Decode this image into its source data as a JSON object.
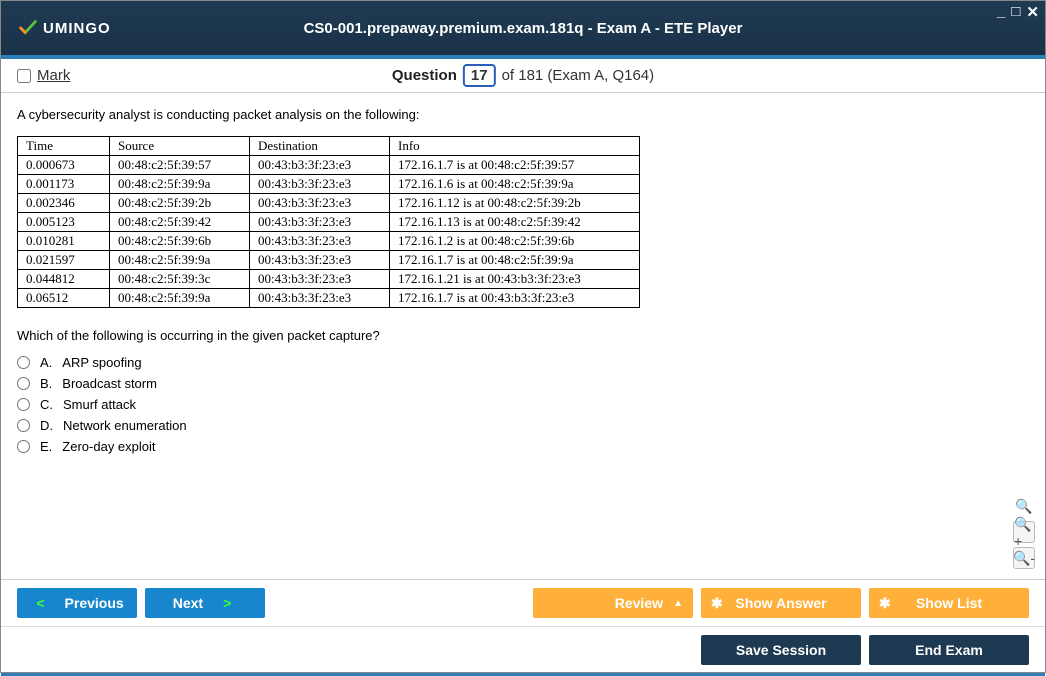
{
  "app": {
    "title": "CS0-001.prepaway.premium.exam.181q - Exam A - ETE Player",
    "brand": "UMINGO"
  },
  "header": {
    "mark_label": "Mark",
    "question_word": "Question",
    "question_num": "17",
    "of_text": "of 181 (Exam A, Q164)"
  },
  "question": {
    "prompt": "A cybersecurity analyst is conducting packet analysis on the following:",
    "followup": "Which of the following is occurring in the given packet capture?",
    "table": {
      "headers": [
        "Time",
        "Source",
        "Destination",
        "Info"
      ],
      "rows": [
        [
          "0.000673",
          "00:48:c2:5f:39:57",
          "00:43:b3:3f:23:e3",
          "172.16.1.7 is at 00:48:c2:5f:39:57"
        ],
        [
          "0.001173",
          "00:48:c2:5f:39:9a",
          "00:43:b3:3f:23:e3",
          "172.16.1.6 is at 00:48:c2:5f:39:9a"
        ],
        [
          "0.002346",
          "00:48:c2:5f:39:2b",
          "00:43:b3:3f:23:e3",
          "172.16.1.12 is at 00:48:c2:5f:39:2b"
        ],
        [
          "0.005123",
          "00:48:c2:5f:39:42",
          "00:43:b3:3f:23:e3",
          "172.16.1.13 is at 00:48:c2:5f:39:42"
        ],
        [
          "0.010281",
          "00:48:c2:5f:39:6b",
          "00:43:b3:3f:23:e3",
          "172.16.1.2 is at 00:48:c2:5f:39:6b"
        ],
        [
          "0.021597",
          "00:48:c2:5f:39:9a",
          "00:43:b3:3f:23:e3",
          "172.16.1.7 is at 00:48:c2:5f:39:9a"
        ],
        [
          "0.044812",
          "00:48:c2:5f:39:3c",
          "00:43:b3:3f:23:e3",
          "172.16.1.21 is at 00:43:b3:3f:23:e3"
        ],
        [
          "0.06512",
          "00:48:c2:5f:39:9a",
          "00:43:b3:3f:23:e3",
          "172.16.1.7 is at 00:43:b3:3f:23:e3"
        ]
      ]
    },
    "options": [
      {
        "letter": "A.",
        "text": "ARP spoofing"
      },
      {
        "letter": "B.",
        "text": "Broadcast storm"
      },
      {
        "letter": "C.",
        "text": "Smurf attack"
      },
      {
        "letter": "D.",
        "text": "Network enumeration"
      },
      {
        "letter": "E.",
        "text": "Zero-day exploit"
      }
    ]
  },
  "buttons": {
    "previous": "Previous",
    "next": "Next",
    "review": "Review",
    "show_answer": "Show Answer",
    "show_list": "Show List",
    "save_session": "Save Session",
    "end_exam": "End Exam"
  }
}
